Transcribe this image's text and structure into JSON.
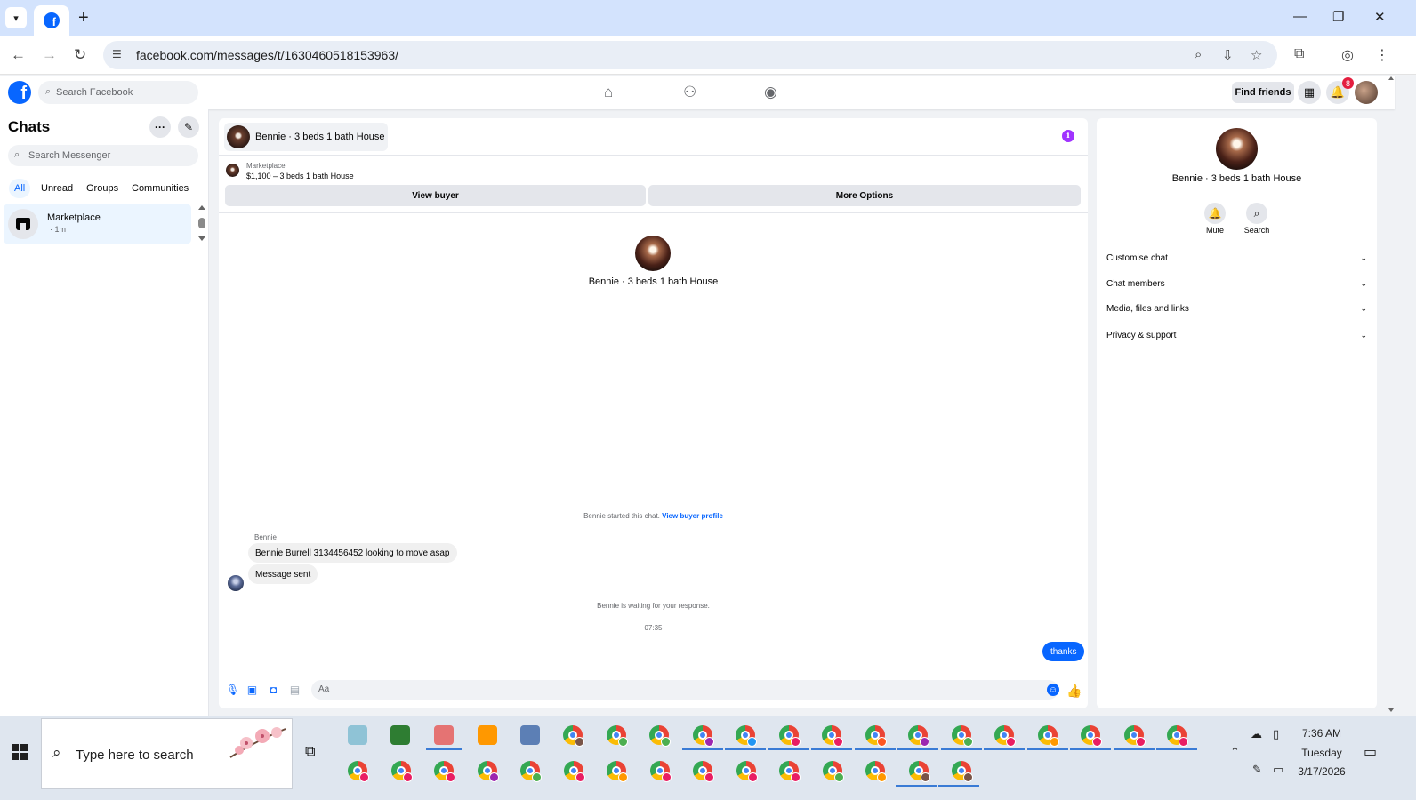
{
  "browser": {
    "url": "facebook.com/messages/t/1630460518153963/",
    "tab_new": "+",
    "window_controls": [
      "—",
      "❐",
      "✕"
    ]
  },
  "facebook": {
    "logo": "f",
    "search_placeholder": "Search Facebook",
    "find_friends": "Find friends",
    "notifications_count": "8"
  },
  "chats": {
    "title": "Chats",
    "more_label": "···",
    "search_placeholder": "Search Messenger",
    "filters": [
      "All",
      "Unread",
      "Groups",
      "Communities"
    ],
    "items": [
      {
        "name": "Marketplace",
        "sub": "· 1m"
      }
    ]
  },
  "conversation": {
    "title": "Bennie · 3 beds 1 bath House",
    "marketplace_label": "Marketplace",
    "listing": "$1,100 – 3 beds 1 bath House",
    "view_buyer": "View buyer",
    "more_options": "More Options",
    "header_name": "Bennie · 3 beds 1 bath House",
    "started_text": "Bennie started this chat.",
    "view_buyer_profile": "View buyer profile",
    "sender": "Bennie",
    "messages": [
      {
        "text": "Bennie Burrell 3134456452 looking to move asap"
      },
      {
        "text": "Message sent"
      }
    ],
    "waiting_text": "Bennie is waiting for your response.",
    "timestamp": "07:35",
    "outgoing": "thanks",
    "composer_placeholder": "Aa"
  },
  "details": {
    "name": "Bennie · 3 beds 1 bath House",
    "actions": [
      "Mute",
      "Search"
    ],
    "sections": [
      "Customise chat",
      "Chat members",
      "Media, files and links",
      "Privacy & support"
    ]
  },
  "taskbar": {
    "search_placeholder": "Type here to search",
    "time": "7:36 AM",
    "day": "Tuesday",
    "date": "3/17/2026"
  },
  "colors": {
    "accent": "#0866ff",
    "browser_tabbar": "#d3e3fd",
    "badge": "#e41e3f",
    "info": "#a033ff"
  },
  "icons": [
    "chevron-down-icon",
    "facebook-favicon",
    "plus-icon",
    "minimize-icon",
    "restore-icon",
    "close-icon",
    "back-icon",
    "forward-icon",
    "reload-icon",
    "site-info-icon",
    "zoom-icon",
    "install-icon",
    "star-icon",
    "extensions-icon",
    "profile-icon",
    "kebab-icon",
    "home-icon",
    "friends-icon",
    "groups-icon",
    "apps-grid-icon",
    "bell-icon",
    "compose-icon",
    "search-icon",
    "store-icon",
    "info-icon",
    "mic-icon",
    "image-icon",
    "sticker-icon",
    "gif-icon",
    "emoji-icon",
    "like-icon",
    "windows-start-icon",
    "task-view-icon",
    "chrome-icon",
    "cloud-icon",
    "chevron-up-icon",
    "notification-center-icon"
  ]
}
